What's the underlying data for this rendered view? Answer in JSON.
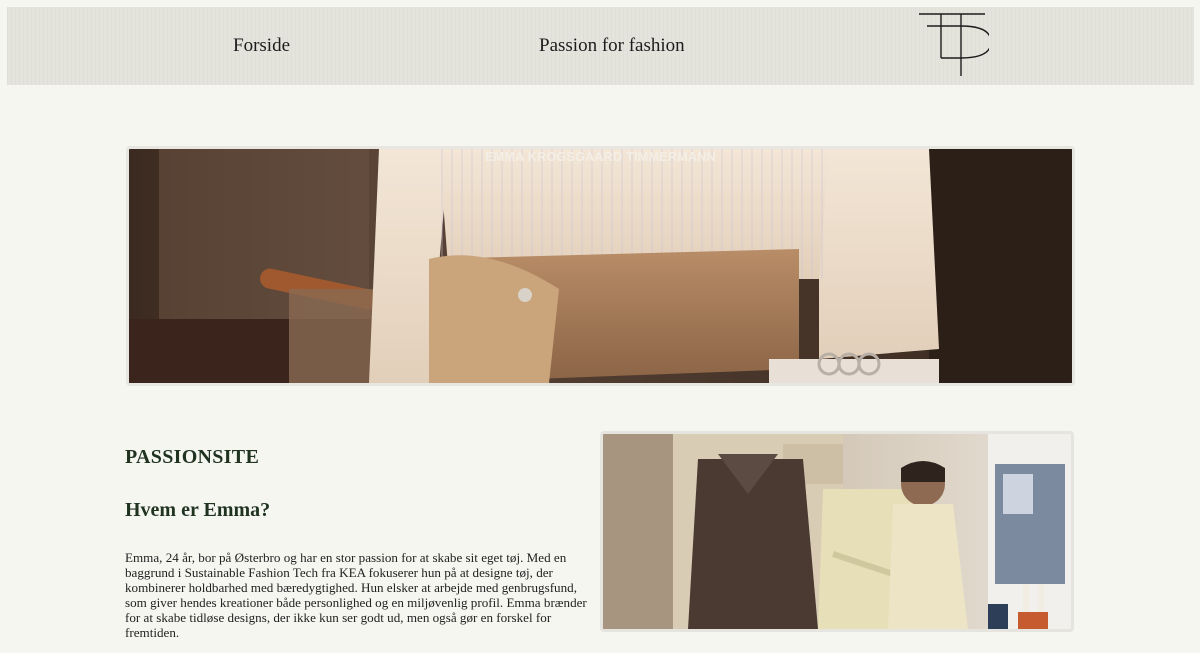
{
  "nav": {
    "home_label": "Forside",
    "passion_label": "Passion for fashion",
    "logo_name": "fp-monogram-logo"
  },
  "hero": {
    "caption": "EMMA KROGSGAARD TIMMERMANN",
    "image": "photo-belt-shirt"
  },
  "about": {
    "site_label": "PASSIONSITE",
    "heading": "Hvem er Emma?",
    "bio": "Emma, 24 år, bor på Østerbro og har en stor passion for at skabe sit eget tøj. Med en baggrund i Sustainable Fashion Tech fra KEA fokuserer hun på at designe tøj, der kombinerer holdbarhed med bæredygtighed. Hun elsker at arbejde med genbrugsfund, som giver hendes kreationer både personlighed og en miljøvenlig profil. Emma brænder for at skabe tidløse designs, der ikke kun ser godt ud, men også gør en forskel for fremtiden."
  },
  "portrait": {
    "image": "photo-emma-with-garments"
  }
}
